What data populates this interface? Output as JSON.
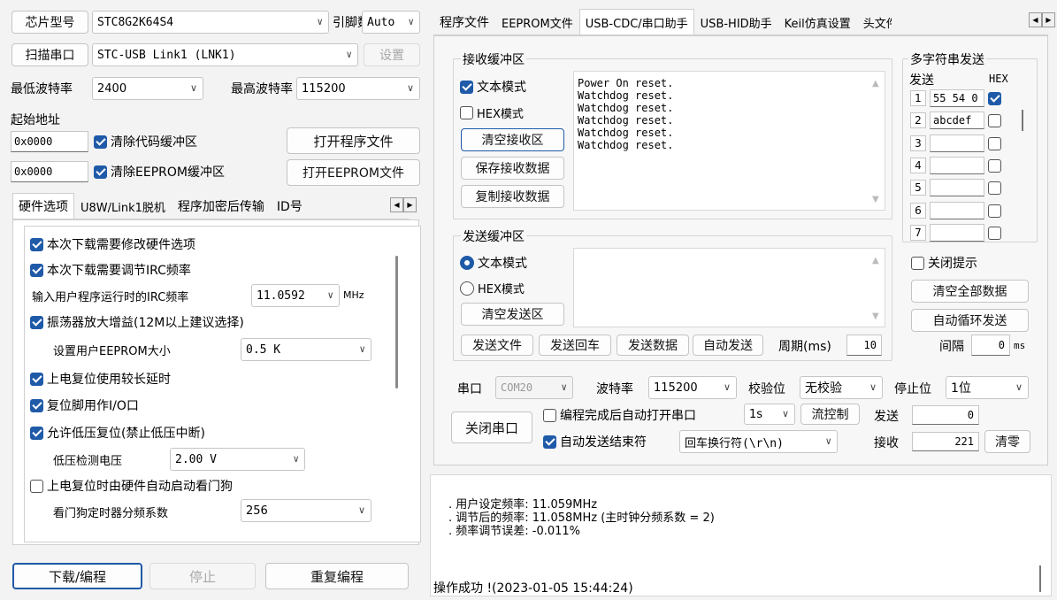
{
  "top": {
    "chip_button": "芯片型号",
    "chip_model": "STC8G2K64S4",
    "pin_label": "引脚数",
    "pin_value": "Auto",
    "scan_button": "扫描串口",
    "port_value": "STC-USB Link1 (LNK1)",
    "settings_button": "设置",
    "min_baud_label": "最低波特率",
    "min_baud_value": "2400",
    "max_baud_label": "最高波特率",
    "max_baud_value": "115200",
    "start_addr_label": "起始地址",
    "addr1": "0x0000",
    "clear_code": "清除代码缓冲区",
    "open_program": "打开程序文件",
    "addr2": "0x0000",
    "clear_eeprom": "清除EEPROM缓冲区",
    "open_eeprom": "打开EEPROM文件"
  },
  "left_tabs": [
    "硬件选项",
    "U8W/Link1脱机",
    "程序加密后传输",
    "ID号"
  ],
  "hw": {
    "opt_modify": "本次下载需要修改硬件选项",
    "opt_irc": "本次下载需要调节IRC频率",
    "irc_label": "输入用户程序运行时的IRC频率",
    "irc_value": "11.0592",
    "irc_unit": "MHz",
    "opt_gain": "振荡器放大增益(12M以上建议选择)",
    "eeprom_label": "设置用户EEPROM大小",
    "eeprom_value": "0.5 K",
    "opt_delay": "上电复位使用较长延时",
    "opt_reset_io": "复位脚用作I/O口",
    "opt_lvr": "允许低压复位(禁止低压中断)",
    "lv_label": "低压检测电压",
    "lv_value": "2.00 V",
    "opt_wdt": "上电复位时由硬件自动启动看门狗",
    "wdt_label": "看门狗定时器分频系数",
    "wdt_value": "256"
  },
  "bottom_left": {
    "download": "下载/编程",
    "stop": "停止",
    "repeat": "重复编程"
  },
  "right_tabs": [
    "程序文件",
    "EEPROM文件",
    "USB-CDC/串口助手",
    "USB-HID助手",
    "Keil仿真设置",
    "头文件"
  ],
  "recv": {
    "title": "接收缓冲区",
    "text_mode": "文本模式",
    "hex_mode": "HEX模式",
    "clear": "清空接收区",
    "save": "保存接收数据",
    "copy": "复制接收数据",
    "lines": [
      "Power On reset.",
      "Watchdog reset.",
      "Watchdog reset.",
      "Watchdog reset.",
      "Watchdog reset.",
      "Watchdog reset."
    ]
  },
  "send": {
    "title": "发送缓冲区",
    "text_mode": "文本模式",
    "hex_mode": "HEX模式",
    "clear": "清空发送区",
    "send_file": "发送文件",
    "send_enter": "发送回车",
    "send_data": "发送数据",
    "auto_send": "自动发送",
    "period_label": "周期(ms)",
    "period_value": "10"
  },
  "multi": {
    "title": "多字符串发送",
    "send_header": "发送",
    "hex_header": "HEX",
    "rows": [
      {
        "n": "1",
        "v": "55 54 0",
        "hex": true
      },
      {
        "n": "2",
        "v": "abcdef",
        "hex": false
      },
      {
        "n": "3",
        "v": "",
        "hex": false
      },
      {
        "n": "4",
        "v": "",
        "hex": false
      },
      {
        "n": "5",
        "v": "",
        "hex": false
      },
      {
        "n": "6",
        "v": "",
        "hex": false
      },
      {
        "n": "7",
        "v": "",
        "hex": false
      }
    ],
    "close_hint": "关闭提示",
    "clear_all": "清空全部数据",
    "auto_loop": "自动循环发送",
    "interval_label": "间隔",
    "interval_value": "0",
    "interval_unit": "ms"
  },
  "serial": {
    "port_label": "串口",
    "port_value": "COM20",
    "baud_label": "波特率",
    "baud_value": "115200",
    "parity_label": "校验位",
    "parity_value": "无校验",
    "stop_label": "停止位",
    "stop_value": "1位",
    "close_port": "关闭串口",
    "auto_open": "编程完成后自动打开串口",
    "auto_open_value": "1s",
    "flow": "流控制",
    "auto_end": "自动发送结束符",
    "end_value": "回车换行符(\\r\\n)",
    "send_label": "发送",
    "send_count": "0",
    "recv_label": "接收",
    "recv_count": "221",
    "clear_count": "清零"
  },
  "log": {
    "line1": "用户设定频率: 11.059MHz",
    "line2": "调节后的频率: 11.058MHz (主时钟分频系数 = 2)",
    "line3": "频率调节误差: -0.011%",
    "status": "操作成功 !(2023-01-05 15:44:24)"
  }
}
